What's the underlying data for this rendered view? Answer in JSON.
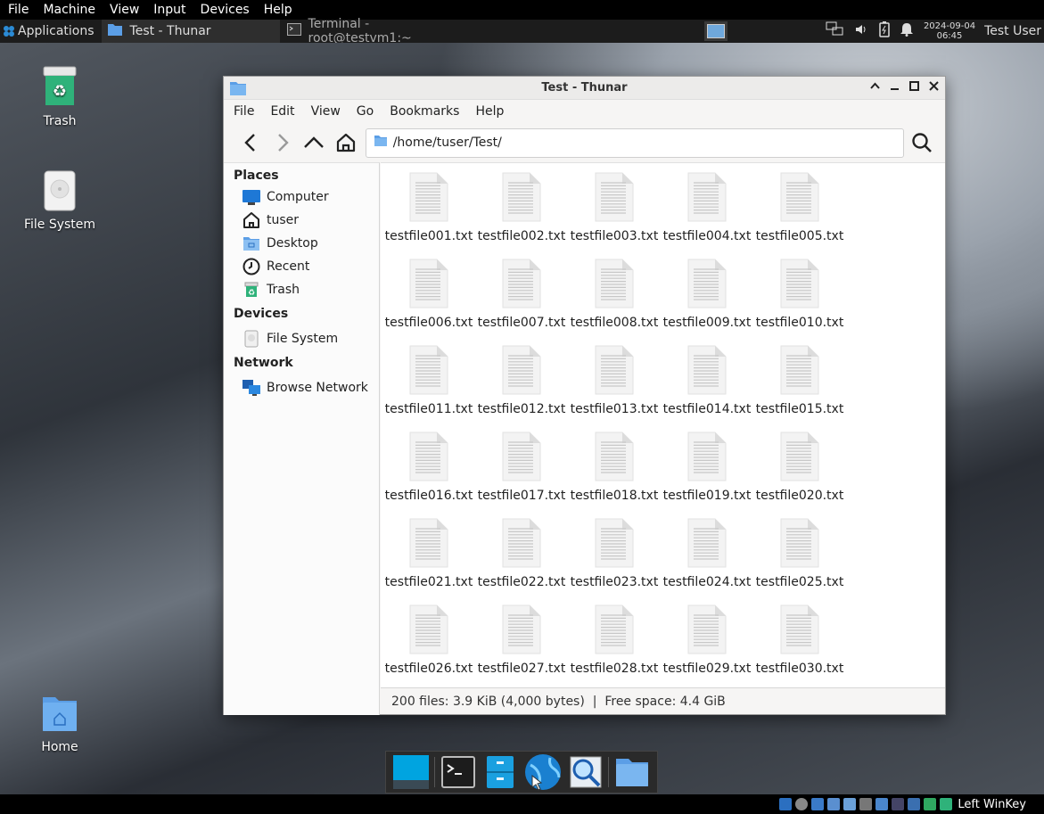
{
  "vm_menu": [
    "File",
    "Machine",
    "View",
    "Input",
    "Devices",
    "Help"
  ],
  "top_panel": {
    "applications": "Applications",
    "tasks": [
      {
        "label": "Test - Thunar",
        "active": true
      },
      {
        "label": "Terminal - root@testvm1:~",
        "active": false
      }
    ],
    "clock_date": "2024-09-04",
    "clock_time": "06:45",
    "user": "Test User"
  },
  "desktop_icons": [
    {
      "label": "Trash",
      "icon": "trash-icon"
    },
    {
      "label": "File System",
      "icon": "drive-icon"
    },
    {
      "label": "Home",
      "icon": "home-folder-icon"
    }
  ],
  "window": {
    "title": "Test - Thunar",
    "menu": [
      "File",
      "Edit",
      "View",
      "Go",
      "Bookmarks",
      "Help"
    ],
    "location": "/home/tuser/Test/",
    "sidebar": {
      "places_heading": "Places",
      "places": [
        {
          "label": "Computer",
          "icon": "computer-icon"
        },
        {
          "label": "tuser",
          "icon": "home-icon"
        },
        {
          "label": "Desktop",
          "icon": "desktop-folder-icon"
        },
        {
          "label": "Recent",
          "icon": "clock-icon"
        },
        {
          "label": "Trash",
          "icon": "trash-icon"
        }
      ],
      "devices_heading": "Devices",
      "devices": [
        {
          "label": "File System",
          "icon": "drive-icon"
        }
      ],
      "network_heading": "Network",
      "network": [
        {
          "label": "Browse Network",
          "icon": "network-icon"
        }
      ]
    },
    "files": [
      "testfile001.txt",
      "testfile002.txt",
      "testfile003.txt",
      "testfile004.txt",
      "testfile005.txt",
      "testfile006.txt",
      "testfile007.txt",
      "testfile008.txt",
      "testfile009.txt",
      "testfile010.txt",
      "testfile011.txt",
      "testfile012.txt",
      "testfile013.txt",
      "testfile014.txt",
      "testfile015.txt",
      "testfile016.txt",
      "testfile017.txt",
      "testfile018.txt",
      "testfile019.txt",
      "testfile020.txt",
      "testfile021.txt",
      "testfile022.txt",
      "testfile023.txt",
      "testfile024.txt",
      "testfile025.txt",
      "testfile026.txt",
      "testfile027.txt",
      "testfile028.txt",
      "testfile029.txt",
      "testfile030.txt"
    ],
    "status": "200 files: 3.9 KiB (4,000 bytes)  |  Free space: 4.4 GiB"
  },
  "vm_status": {
    "host_key": "Left WinKey"
  },
  "colors": {
    "accent": "#1e90d6",
    "folder": "#5b9ee6",
    "trash_green": "#2fb27a"
  }
}
